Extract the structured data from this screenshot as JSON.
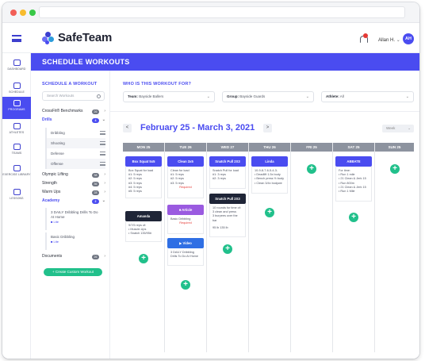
{
  "app": {
    "name": "SafeTeam"
  },
  "user": {
    "name": "Allan H.",
    "initials": "AH"
  },
  "nav": [
    {
      "label": "DASHBOARD"
    },
    {
      "label": "SCHEDULE"
    },
    {
      "label": "PROGRAMS"
    },
    {
      "label": "ATHLETES"
    },
    {
      "label": "TEAMS"
    },
    {
      "label": "EXERCISE LIBRARY"
    },
    {
      "label": "LESSONS"
    }
  ],
  "page_title": "SCHEDULE WORKOUTS",
  "left": {
    "section_title": "SCHEDULE A WORKOUT",
    "search_placeholder": "Search Workouts",
    "categories": [
      {
        "label": "CrossFit® Benchmarks",
        "count": "26"
      },
      {
        "label": "Drills",
        "count": "4"
      },
      {
        "label": "Olympic Lifting",
        "count": "38"
      },
      {
        "label": "Strength",
        "count": "36"
      },
      {
        "label": "Warm Ups",
        "count": "28"
      },
      {
        "label": "Academy",
        "count": "2"
      },
      {
        "label": "Documents",
        "count": "26"
      }
    ],
    "drills": [
      "Dribbling",
      "Shooting",
      "Defense",
      "Offense"
    ],
    "academy_items": [
      {
        "title": "3 DAILY Dribbling Drills To Do At Home",
        "tag": "Lite"
      },
      {
        "title": "Basic Dribbling",
        "tag": "Lite"
      }
    ],
    "create_button": "+ Create Custom Workout"
  },
  "filters": {
    "question": "WHO IS THIS WORKOUT FOR?",
    "team": {
      "label": "Team:",
      "value": "Bayside Ballers"
    },
    "group": {
      "label": "Group:",
      "value": "Bayside Guards"
    },
    "athlete": {
      "label": "Athlete:",
      "value": "All"
    }
  },
  "calendar": {
    "range": "February 25 - March 3, 2021",
    "prev": "<",
    "next": ">",
    "view": "Week",
    "days": [
      "MON 25",
      "TUE 26",
      "WED 27",
      "THU 26",
      "FRI 25",
      "SAT 25",
      "SUN 25"
    ],
    "cards": {
      "mon1_title": "Box Squat 5x5",
      "mon1_body": "Box Squat for load\n#1: 5 reps\n#2: 5 reps\n#3: 5 reps\n#4: 5 reps\n#5: 5 reps",
      "mon2_title": "Amanda",
      "mon2_body": "9/7/5 reps of:\n• Muscle-Ups\n• Snatch 135/95#",
      "tue1_title": "Clean 3x5",
      "tue1_body": "Clean for load\n#1: 5 reps\n#2: 5 reps\n#3: 5 reps",
      "tue1_req": "Required",
      "tue2_title": "Article",
      "tue2_body": "Basic Dribbling",
      "tue2_req": "Required",
      "tue3_title": "Video",
      "tue3_body": "3 DAILY Dribbling Drills To Do At Home",
      "wed1_title": "Snatch Pull 2X3",
      "wed1_body": "Snatch Pull for load\n#1: 3 reps\n#2: 3 reps",
      "wed2_title": "Snatch Pull 2X3",
      "wed2_body": "10 rounds for time of:\n3 clean and press\n3 burpees over the bar",
      "wed2_meta": "95 lb   135 lb",
      "thu1_title": "Linda",
      "thu1_body": "10-9-8-7-6-5-4-3-\n• Deadlift 1.5x body\n• Bench press ½ body\n• Clean 3/4x bodywe",
      "sat1_title": "ABBATE",
      "sat1_body": "For time:\n• Run 1 mile\n• 21 Clean & Jerk 15\n• Run 800m\n• 21 Clean & Jerk 15\n• Run 1 Mile"
    }
  }
}
